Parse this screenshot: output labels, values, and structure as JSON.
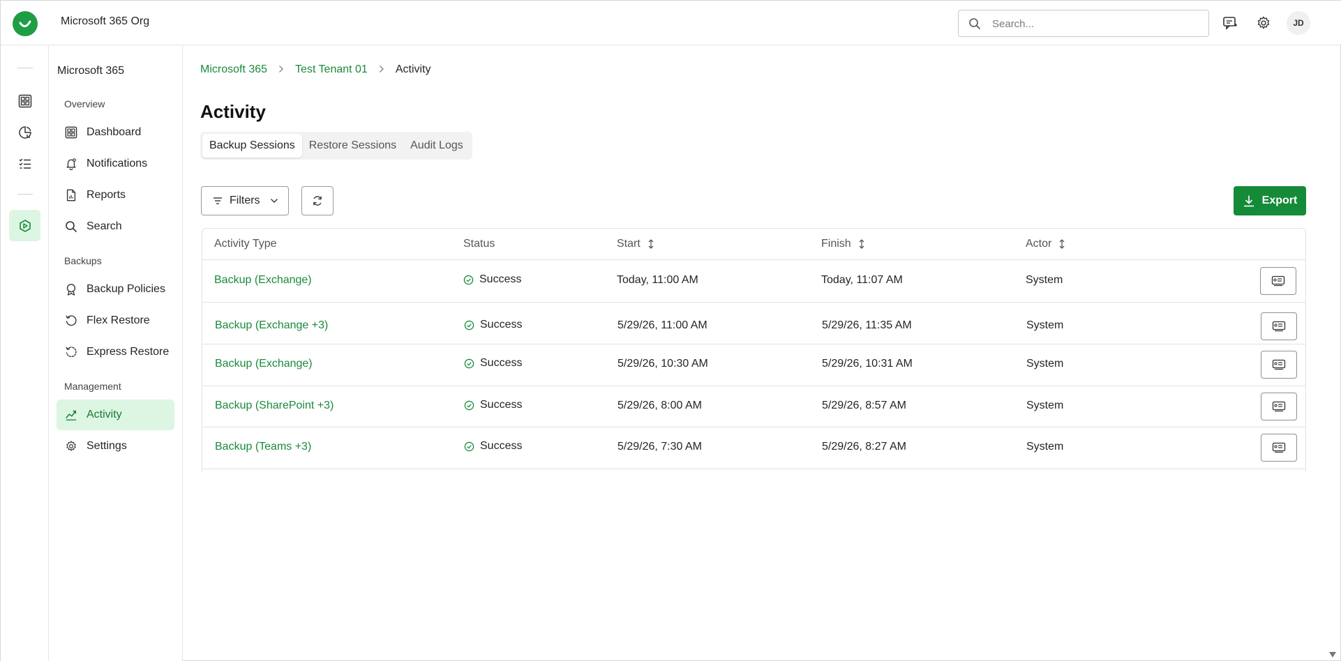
{
  "app": {
    "org_name": "Microsoft 365 Org",
    "avatar_initials": "JD",
    "search_placeholder": "Search...",
    "accent": "#1a8a3c"
  },
  "sidebar": {
    "title": "Microsoft 365",
    "sections": {
      "overview": "Overview",
      "backups": "Backups",
      "management": "Management"
    },
    "items": [
      {
        "label": "Dashboard",
        "icon": "dashboard-icon"
      },
      {
        "label": "Notifications",
        "icon": "bell-icon"
      },
      {
        "label": "Reports",
        "icon": "report-icon"
      },
      {
        "label": "Search",
        "icon": "search-icon"
      },
      {
        "label": "Backup Policies",
        "icon": "policy-icon"
      },
      {
        "label": "Flex Restore",
        "icon": "restore-icon"
      },
      {
        "label": "Express Restore",
        "icon": "express-restore-icon"
      },
      {
        "label": "Activity",
        "icon": "activity-icon",
        "active": true
      },
      {
        "label": "Settings",
        "icon": "gear-icon"
      }
    ]
  },
  "breadcrumb": {
    "items": [
      "Microsoft 365",
      "Test Tenant 01"
    ],
    "current": "Activity"
  },
  "page": {
    "title": "Activity",
    "tabs": [
      {
        "label": "Backup Sessions",
        "active": true
      },
      {
        "label": "Restore Sessions"
      },
      {
        "label": "Audit Logs"
      }
    ],
    "filters_label": "Filters",
    "export_label": "Export"
  },
  "table": {
    "columns": [
      "Activity Type",
      "Status",
      "Start",
      "Finish",
      "Actor"
    ],
    "rows": [
      {
        "type": "Backup (Exchange)",
        "status": "Success",
        "start": "Today, 11:00 AM",
        "finish": "Today, 11:07 AM",
        "actor": "System"
      },
      {
        "type": "Backup (Exchange +3)",
        "status": "Success",
        "start": "5/29/26, 11:00 AM",
        "finish": "5/29/26, 11:35 AM",
        "actor": "System"
      },
      {
        "type": "Backup (Exchange)",
        "status": "Success",
        "start": "5/29/26, 10:30 AM",
        "finish": "5/29/26, 10:31 AM",
        "actor": "System"
      },
      {
        "type": "Backup (SharePoint +3)",
        "status": "Success",
        "start": "5/29/26, 8:00 AM",
        "finish": "5/29/26, 8:57 AM",
        "actor": "System"
      },
      {
        "type": "Backup (Teams +3)",
        "status": "Success",
        "start": "5/29/26, 7:30 AM",
        "finish": "5/29/26, 8:27 AM",
        "actor": "System"
      }
    ]
  }
}
